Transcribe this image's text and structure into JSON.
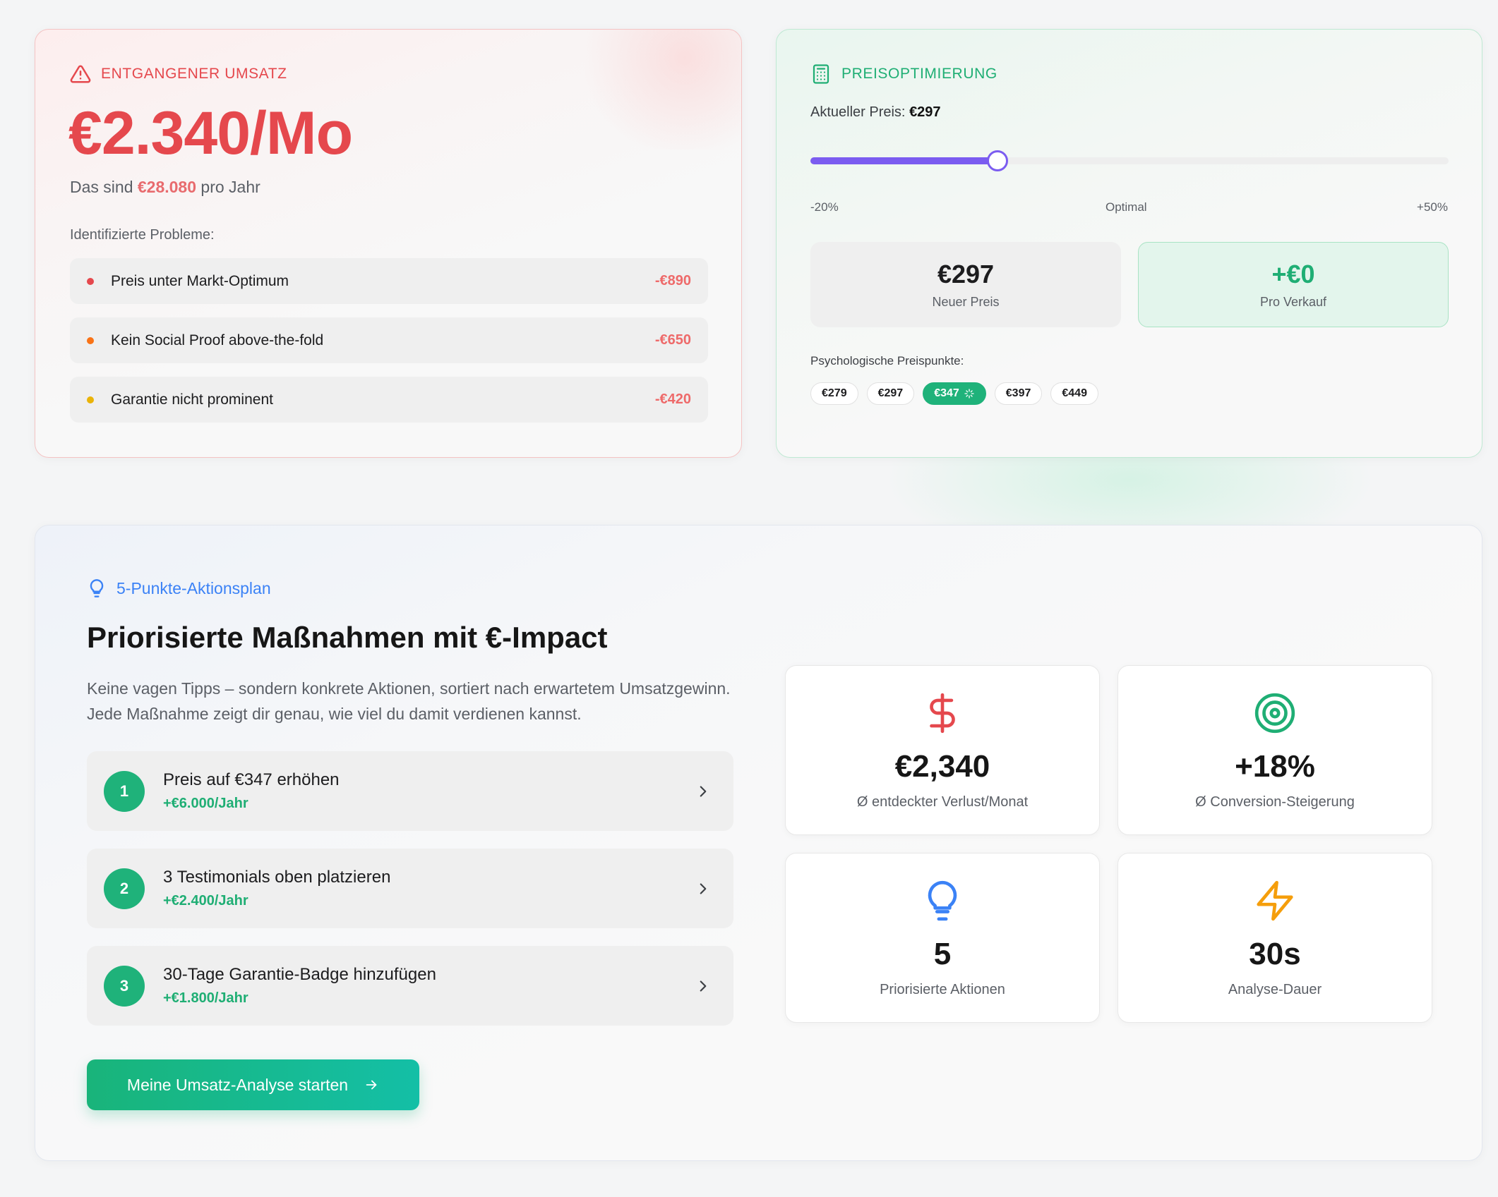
{
  "loss": {
    "eyebrow": "ENTGANGENER UMSATZ",
    "amount": "€2.340/Mo",
    "year_prefix": "Das sind ",
    "year_value": "€28.080",
    "year_suffix": " pro Jahr",
    "issues_label": "Identifizierte Probleme:",
    "issues": [
      {
        "text": "Preis unter Markt-Optimum",
        "value": "-€890",
        "color": "#e5484d"
      },
      {
        "text": "Kein Social Proof above-the-fold",
        "value": "-€650",
        "color": "#f97316"
      },
      {
        "text": "Garantie nicht prominent",
        "value": "-€420",
        "color": "#eab308"
      }
    ]
  },
  "pricing": {
    "eyebrow": "PREISOPTIMIERUNG",
    "current_label": "Aktueller Preis: ",
    "current_value": "€297",
    "slider_fraction": 0.293,
    "scale_min": "-20%",
    "scale_mid": "Optimal",
    "scale_max": "+50%",
    "new_price": "€297",
    "new_price_label": "Neuer Preis",
    "per_sale": "+€0",
    "per_sale_label": "Pro Verkauf",
    "psy_label": "Psychologische Preispunkte:",
    "chips": [
      "€279",
      "€297",
      "€347",
      "€397",
      "€449"
    ],
    "active_chip_index": 2
  },
  "plan": {
    "eyebrow": "5-Punkte-Aktionsplan",
    "title": "Priorisierte Maßnahmen mit €-Impact",
    "description": "Keine vagen Tipps – sondern konkrete Aktionen, sortiert nach erwartetem Umsatzgewinn. Jede Maßnahme zeigt dir genau, wie viel du damit verdienen kannst.",
    "actions": [
      {
        "num": "1",
        "title": "Preis auf €347 erhöhen",
        "gain": "+€6.000/Jahr"
      },
      {
        "num": "2",
        "title": "3 Testimonials oben platzieren",
        "gain": "+€2.400/Jahr"
      },
      {
        "num": "3",
        "title": "30-Tage Garantie-Badge hinzufügen",
        "gain": "+€1.800/Jahr"
      }
    ],
    "cta": "Meine Umsatz-Analyse starten",
    "stats": [
      {
        "icon": "dollar-icon",
        "value": "€2,340",
        "label": "Ø entdeckter Verlust/Monat"
      },
      {
        "icon": "target-icon",
        "value": "+18%",
        "label": "Ø Conversion-Steigerung"
      },
      {
        "icon": "lightbulb-icon",
        "value": "5",
        "label": "Priorisierte Aktionen"
      },
      {
        "icon": "lightning-icon",
        "value": "30s",
        "label": "Analyse-Dauer"
      }
    ]
  },
  "colors": {
    "loss_red": "#e5484d",
    "success_green": "#1fae74",
    "slider_purple": "#7b5cf0",
    "info_blue": "#3b82f6",
    "lightning_orange": "#f59e0b"
  }
}
